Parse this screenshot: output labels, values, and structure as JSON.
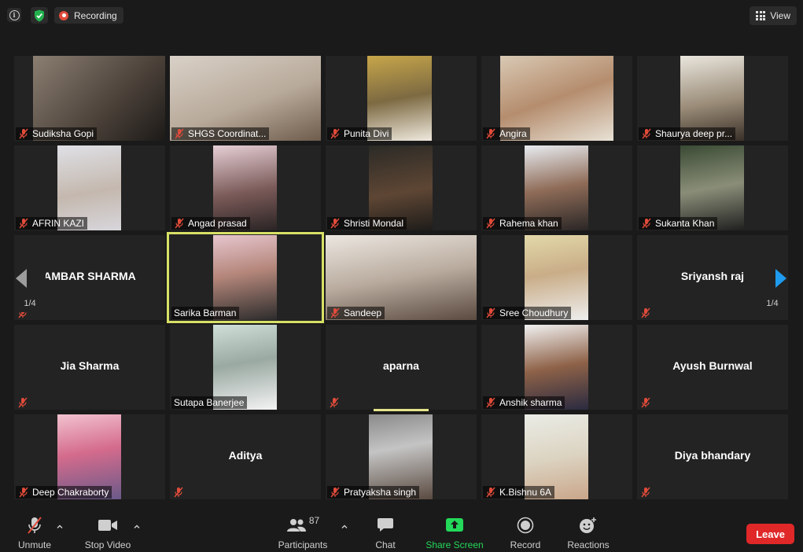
{
  "topbar": {
    "recording_label": "Recording",
    "view_label": "View",
    "icons": [
      "info-icon",
      "shield-check-icon",
      "record-icon",
      "grid-view-icon"
    ]
  },
  "tiles": [
    {
      "name": "Sudiksha Gopi",
      "video": true
    },
    {
      "name": "SHGS Coordinat...",
      "video": true
    },
    {
      "name": "Punita Divi",
      "video": true
    },
    {
      "name": "Angira",
      "video": true
    },
    {
      "name": "Shaurya deep pr...",
      "video": true
    },
    {
      "name": "AFRIN KAZI",
      "video": true
    },
    {
      "name": "Angad prasad",
      "video": true
    },
    {
      "name": "Shristi Mondal",
      "video": true
    },
    {
      "name": "Rahema khan",
      "video": true
    },
    {
      "name": "Sukanta Khan",
      "video": true
    },
    {
      "name": "AMBAR SHARMA",
      "video": false
    },
    {
      "name": "Sarika Barman",
      "video": true,
      "active": true
    },
    {
      "name": "Sandeep",
      "video": true
    },
    {
      "name": "Sree Choudhury",
      "video": true
    },
    {
      "name": "Sriyansh raj",
      "video": false
    },
    {
      "name": "Jia Sharma",
      "video": false
    },
    {
      "name": "Sutapa Banerjee",
      "video": true
    },
    {
      "name": "aparna",
      "video": false
    },
    {
      "name": "Anshik sharma",
      "video": true
    },
    {
      "name": "Ayush Burnwal",
      "video": false
    },
    {
      "name": "Deep Chakraborty",
      "video": true
    },
    {
      "name": "Aditya",
      "video": false
    },
    {
      "name": "Pratyaksha singh",
      "video": true
    },
    {
      "name": "K.Bishnu 6A",
      "video": true
    },
    {
      "name": "Diya bhandary",
      "video": false
    }
  ],
  "pagination": {
    "left": "1/4",
    "right": "1/4"
  },
  "toolbar": {
    "unmute": "Unmute",
    "stop_video": "Stop Video",
    "participants": "Participants",
    "participants_count": "87",
    "chat": "Chat",
    "share_screen": "Share Screen",
    "record": "Record",
    "reactions": "Reactions",
    "leave": "Leave"
  },
  "colors": {
    "background": "#1a1a1a",
    "tile": "#232323",
    "muted_red": "#e04b3a",
    "share_green": "#23d959",
    "active_border": "#d8e066",
    "nav_arrow": "#1e9bef",
    "leave_red": "#e02828"
  }
}
